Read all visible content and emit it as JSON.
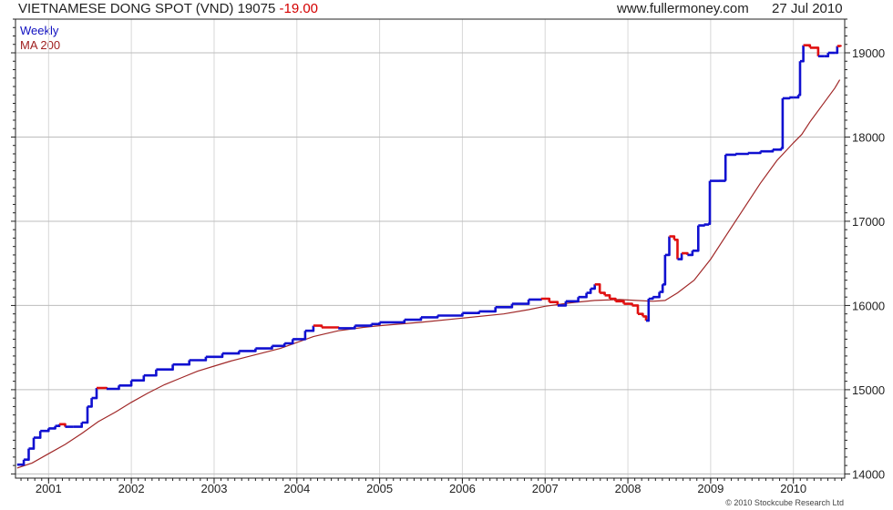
{
  "header": {
    "title": "VIETNAMESE DONG SPOT (VND) 19075",
    "change": "-19.00",
    "website": "www.fullermoney.com",
    "date": "27 Jul 2010"
  },
  "legend": {
    "price_label": "Weekly",
    "ma_label": "MA 200"
  },
  "footer": {
    "credit": "© 2010 Stockcube Research Ltd"
  },
  "colors": {
    "up": "#1010d0",
    "down": "#e01010",
    "ma": "#a02828",
    "grid": "#d8d8d8",
    "axis": "#222222"
  },
  "chart_data": {
    "type": "line",
    "title": "VIETNAMESE DONG SPOT (VND) 19075 -19.00",
    "xlabel": "",
    "ylabel": "",
    "xlim": [
      2000.6,
      2010.62
    ],
    "ylim": [
      13950,
      19400
    ],
    "x_ticks": [
      2001,
      2002,
      2003,
      2004,
      2005,
      2006,
      2007,
      2008,
      2009,
      2010
    ],
    "y_ticks": [
      14000,
      15000,
      16000,
      17000,
      18000,
      19000
    ],
    "grid": true,
    "legend_position": "top-left",
    "series": [
      {
        "name": "Weekly",
        "style": "price bars, blue up / red down",
        "points": [
          [
            2000.62,
            14110
          ],
          [
            2000.7,
            14170
          ],
          [
            2000.76,
            14300
          ],
          [
            2000.82,
            14430
          ],
          [
            2000.9,
            14510
          ],
          [
            2001.0,
            14540
          ],
          [
            2001.08,
            14570
          ],
          [
            2001.13,
            14590
          ],
          [
            2001.2,
            14560
          ],
          [
            2001.3,
            14560
          ],
          [
            2001.4,
            14610
          ],
          [
            2001.47,
            14800
          ],
          [
            2001.52,
            14900
          ],
          [
            2001.58,
            15020
          ],
          [
            2001.7,
            15010
          ],
          [
            2001.85,
            15050
          ],
          [
            2002.0,
            15110
          ],
          [
            2002.15,
            15170
          ],
          [
            2002.3,
            15240
          ],
          [
            2002.5,
            15300
          ],
          [
            2002.7,
            15350
          ],
          [
            2002.9,
            15390
          ],
          [
            2003.1,
            15430
          ],
          [
            2003.3,
            15460
          ],
          [
            2003.5,
            15490
          ],
          [
            2003.7,
            15520
          ],
          [
            2003.85,
            15550
          ],
          [
            2003.95,
            15600
          ],
          [
            2004.1,
            15700
          ],
          [
            2004.2,
            15760
          ],
          [
            2004.3,
            15740
          ],
          [
            2004.5,
            15730
          ],
          [
            2004.7,
            15760
          ],
          [
            2004.9,
            15780
          ],
          [
            2005.0,
            15800
          ],
          [
            2005.3,
            15830
          ],
          [
            2005.5,
            15860
          ],
          [
            2005.7,
            15880
          ],
          [
            2006.0,
            15910
          ],
          [
            2006.2,
            15930
          ],
          [
            2006.4,
            15980
          ],
          [
            2006.6,
            16020
          ],
          [
            2006.8,
            16070
          ],
          [
            2006.95,
            16080
          ],
          [
            2007.05,
            16040
          ],
          [
            2007.15,
            16000
          ],
          [
            2007.25,
            16050
          ],
          [
            2007.4,
            16100
          ],
          [
            2007.5,
            16150
          ],
          [
            2007.55,
            16200
          ],
          [
            2007.6,
            16250
          ],
          [
            2007.66,
            16150
          ],
          [
            2007.72,
            16120
          ],
          [
            2007.78,
            16080
          ],
          [
            2007.85,
            16050
          ],
          [
            2007.95,
            16020
          ],
          [
            2008.05,
            16000
          ],
          [
            2008.12,
            15900
          ],
          [
            2008.18,
            15870
          ],
          [
            2008.22,
            15820
          ],
          [
            2008.25,
            16080
          ],
          [
            2008.3,
            16100
          ],
          [
            2008.38,
            16160
          ],
          [
            2008.42,
            16250
          ],
          [
            2008.45,
            16600
          ],
          [
            2008.5,
            16820
          ],
          [
            2008.56,
            16780
          ],
          [
            2008.6,
            16550
          ],
          [
            2008.65,
            16620
          ],
          [
            2008.72,
            16600
          ],
          [
            2008.78,
            16650
          ],
          [
            2008.85,
            16950
          ],
          [
            2008.92,
            16960
          ],
          [
            2008.97,
            16970
          ],
          [
            2008.99,
            17480
          ],
          [
            2009.1,
            17480
          ],
          [
            2009.17,
            17490
          ],
          [
            2009.18,
            17790
          ],
          [
            2009.3,
            17800
          ],
          [
            2009.45,
            17810
          ],
          [
            2009.6,
            17830
          ],
          [
            2009.75,
            17850
          ],
          [
            2009.85,
            17870
          ],
          [
            2009.87,
            18460
          ],
          [
            2009.95,
            18470
          ],
          [
            2010.0,
            18470
          ],
          [
            2010.06,
            18500
          ],
          [
            2010.08,
            18900
          ],
          [
            2010.12,
            19090
          ],
          [
            2010.2,
            19060
          ],
          [
            2010.3,
            18960
          ],
          [
            2010.37,
            18960
          ],
          [
            2010.42,
            19000
          ],
          [
            2010.5,
            19000
          ],
          [
            2010.53,
            19080
          ],
          [
            2010.57,
            19075
          ]
        ]
      },
      {
        "name": "MA 200",
        "style": "line",
        "points": [
          [
            2000.62,
            14070
          ],
          [
            2000.8,
            14130
          ],
          [
            2001.0,
            14240
          ],
          [
            2001.2,
            14350
          ],
          [
            2001.4,
            14480
          ],
          [
            2001.6,
            14620
          ],
          [
            2001.8,
            14730
          ],
          [
            2002.0,
            14850
          ],
          [
            2002.2,
            14960
          ],
          [
            2002.4,
            15060
          ],
          [
            2002.6,
            15140
          ],
          [
            2002.8,
            15220
          ],
          [
            2003.0,
            15280
          ],
          [
            2003.2,
            15340
          ],
          [
            2003.4,
            15390
          ],
          [
            2003.6,
            15440
          ],
          [
            2003.8,
            15490
          ],
          [
            2004.0,
            15560
          ],
          [
            2004.2,
            15630
          ],
          [
            2004.5,
            15700
          ],
          [
            2004.8,
            15740
          ],
          [
            2005.0,
            15760
          ],
          [
            2005.5,
            15800
          ],
          [
            2006.0,
            15850
          ],
          [
            2006.5,
            15900
          ],
          [
            2006.8,
            15950
          ],
          [
            2007.0,
            15990
          ],
          [
            2007.3,
            16030
          ],
          [
            2007.6,
            16060
          ],
          [
            2007.9,
            16070
          ],
          [
            2008.1,
            16060
          ],
          [
            2008.3,
            16050
          ],
          [
            2008.45,
            16060
          ],
          [
            2008.6,
            16150
          ],
          [
            2008.8,
            16300
          ],
          [
            2009.0,
            16550
          ],
          [
            2009.2,
            16850
          ],
          [
            2009.4,
            17150
          ],
          [
            2009.6,
            17450
          ],
          [
            2009.8,
            17720
          ],
          [
            2010.0,
            17930
          ],
          [
            2010.1,
            18030
          ],
          [
            2010.2,
            18180
          ],
          [
            2010.35,
            18380
          ],
          [
            2010.5,
            18580
          ],
          [
            2010.56,
            18680
          ]
        ]
      }
    ]
  }
}
